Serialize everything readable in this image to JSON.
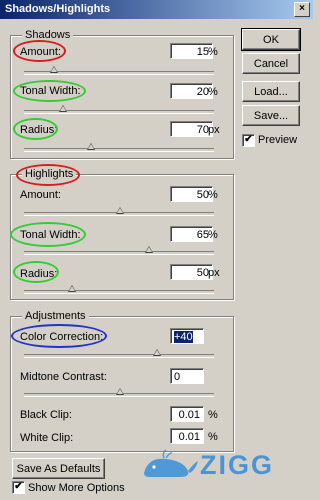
{
  "window": {
    "title": "Shadows/Highlights",
    "close_glyph": "×"
  },
  "shadows": {
    "legend": "Shadows",
    "amount": {
      "label": "Amount:",
      "value": "15",
      "unit": "%"
    },
    "tonal_width": {
      "label": "Tonal Width:",
      "value": "20",
      "unit": "%"
    },
    "radius": {
      "label": "Radius:",
      "value": "70",
      "unit": "px"
    }
  },
  "highlights": {
    "legend": "Highlights",
    "amount": {
      "label": "Amount:",
      "value": "50",
      "unit": "%"
    },
    "tonal_width": {
      "label": "Tonal Width:",
      "value": "65",
      "unit": "%"
    },
    "radius": {
      "label": "Radius:",
      "value": "50",
      "unit": "px"
    }
  },
  "adjustments": {
    "legend": "Adjustments",
    "color_correction": {
      "label": "Color Correction:",
      "value": "+40"
    },
    "midtone_contrast": {
      "label": "Midtone Contrast:",
      "value": "0"
    },
    "black_clip": {
      "label": "Black Clip:",
      "value": "0.01",
      "unit": "%"
    },
    "white_clip": {
      "label": "White Clip:",
      "value": "0.01",
      "unit": "%"
    }
  },
  "buttons": {
    "ok": "OK",
    "cancel": "Cancel",
    "load": "Load...",
    "save": "Save...",
    "save_defaults": "Save As Defaults"
  },
  "preview": {
    "label": "Preview",
    "checked": true,
    "check_glyph": "✔"
  },
  "show_more": {
    "label": "Show More Options",
    "checked": true,
    "check_glyph": "✔"
  },
  "watermark": {
    "text": "ZIGG",
    "icon": "whale-icon"
  },
  "colors": {
    "title_bar": "#0a246a",
    "annotation_red": "#d42020",
    "annotation_green": "#33cc33",
    "annotation_blue": "#2233cc",
    "watermark": "#3a8fd8"
  }
}
